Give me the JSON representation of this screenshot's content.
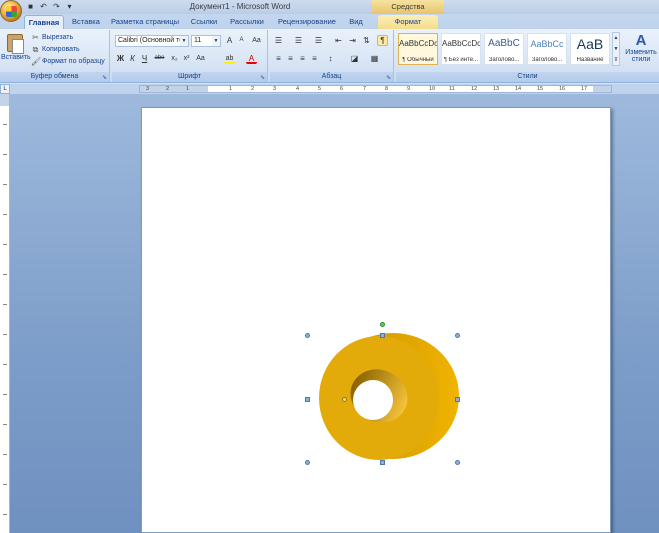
{
  "title_bar": {
    "title": "Документ1 - Microsoft Word",
    "contextual_tools": "Средства рисования"
  },
  "tabs": [
    {
      "label": "Главная",
      "active": true
    },
    {
      "label": "Вставка"
    },
    {
      "label": "Разметка страницы"
    },
    {
      "label": "Ссылки"
    },
    {
      "label": "Рассылки"
    },
    {
      "label": "Рецензирование"
    },
    {
      "label": "Вид"
    },
    {
      "label": "Формат",
      "contextual": true
    }
  ],
  "clipboard": {
    "paste": "Вставить",
    "cut": "Вырезать",
    "copy": "Копировать",
    "format_painter": "Формат по образцу",
    "group_label": "Буфер обмена"
  },
  "font": {
    "name": "Calibri (Основной те",
    "size": "11",
    "group_label": "Шрифт",
    "grow": "A",
    "shrink": "A",
    "clear": "Aa",
    "bold": "Ж",
    "italic": "К",
    "underline": "Ч",
    "strike": "abe",
    "subscript": "x₂",
    "superscript": "x²",
    "change_case": "Aa",
    "highlight": "ab",
    "font_color": "A"
  },
  "paragraph": {
    "group_label": "Абзац",
    "show_marks": "¶"
  },
  "styles": {
    "group_label": "Стили",
    "items": [
      {
        "sample": "AaBbCcDc",
        "name": "¶ Обычный",
        "selected": true
      },
      {
        "sample": "AaBbCcDc",
        "name": "¶ Без инте..."
      },
      {
        "sample": "AaBbC",
        "name": "Заголово..."
      },
      {
        "sample": "AaBbCc",
        "name": "Заголово..."
      },
      {
        "sample": "AaB",
        "name": "Название"
      }
    ],
    "change_styles": "Изменить стили",
    "change_styles_icon": "A"
  },
  "ruler": {
    "numbers": [
      "3",
      "2",
      "1",
      "1",
      "2",
      "3",
      "4",
      "5",
      "6",
      "7",
      "8",
      "9",
      "10",
      "11",
      "12",
      "13",
      "14",
      "15",
      "16",
      "17"
    ]
  },
  "shape": {
    "type": "donut-3d",
    "fill": "#e0a800"
  },
  "colors": {
    "ribbon_text": "#15428b",
    "shape_face": "#e3ab0a",
    "shape_side": "#b88400"
  }
}
